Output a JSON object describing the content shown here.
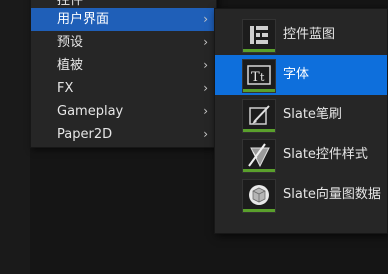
{
  "main_menu": {
    "top_partial_label": "控件",
    "items": [
      {
        "label": "用户界面",
        "has_submenu": true,
        "highlighted": true
      },
      {
        "label": "预设",
        "has_submenu": true,
        "highlighted": false
      },
      {
        "label": "植被",
        "has_submenu": true,
        "highlighted": false
      },
      {
        "label": "FX",
        "has_submenu": true,
        "highlighted": false
      },
      {
        "label": "Gameplay",
        "has_submenu": true,
        "highlighted": false
      },
      {
        "label": "Paper2D",
        "has_submenu": true,
        "highlighted": false
      }
    ],
    "chevron": "›"
  },
  "sub_menu": {
    "items": [
      {
        "label": "控件蓝图",
        "icon": "widget-blueprint-icon",
        "highlighted": false
      },
      {
        "label": "字体",
        "icon": "font-icon",
        "highlighted": true
      },
      {
        "label": "Slate笔刷",
        "icon": "slate-brush-icon",
        "highlighted": false
      },
      {
        "label": "Slate控件样式",
        "icon": "slate-widget-style-icon",
        "highlighted": false
      },
      {
        "label": "Slate向量图数据",
        "icon": "slate-vector-art-icon",
        "highlighted": false
      }
    ]
  },
  "colors": {
    "menu_bg": "#262626",
    "highlight_main": "#1f5fb8",
    "highlight_sub": "#0e6fdc",
    "asset_bar": "#5aa02c"
  }
}
